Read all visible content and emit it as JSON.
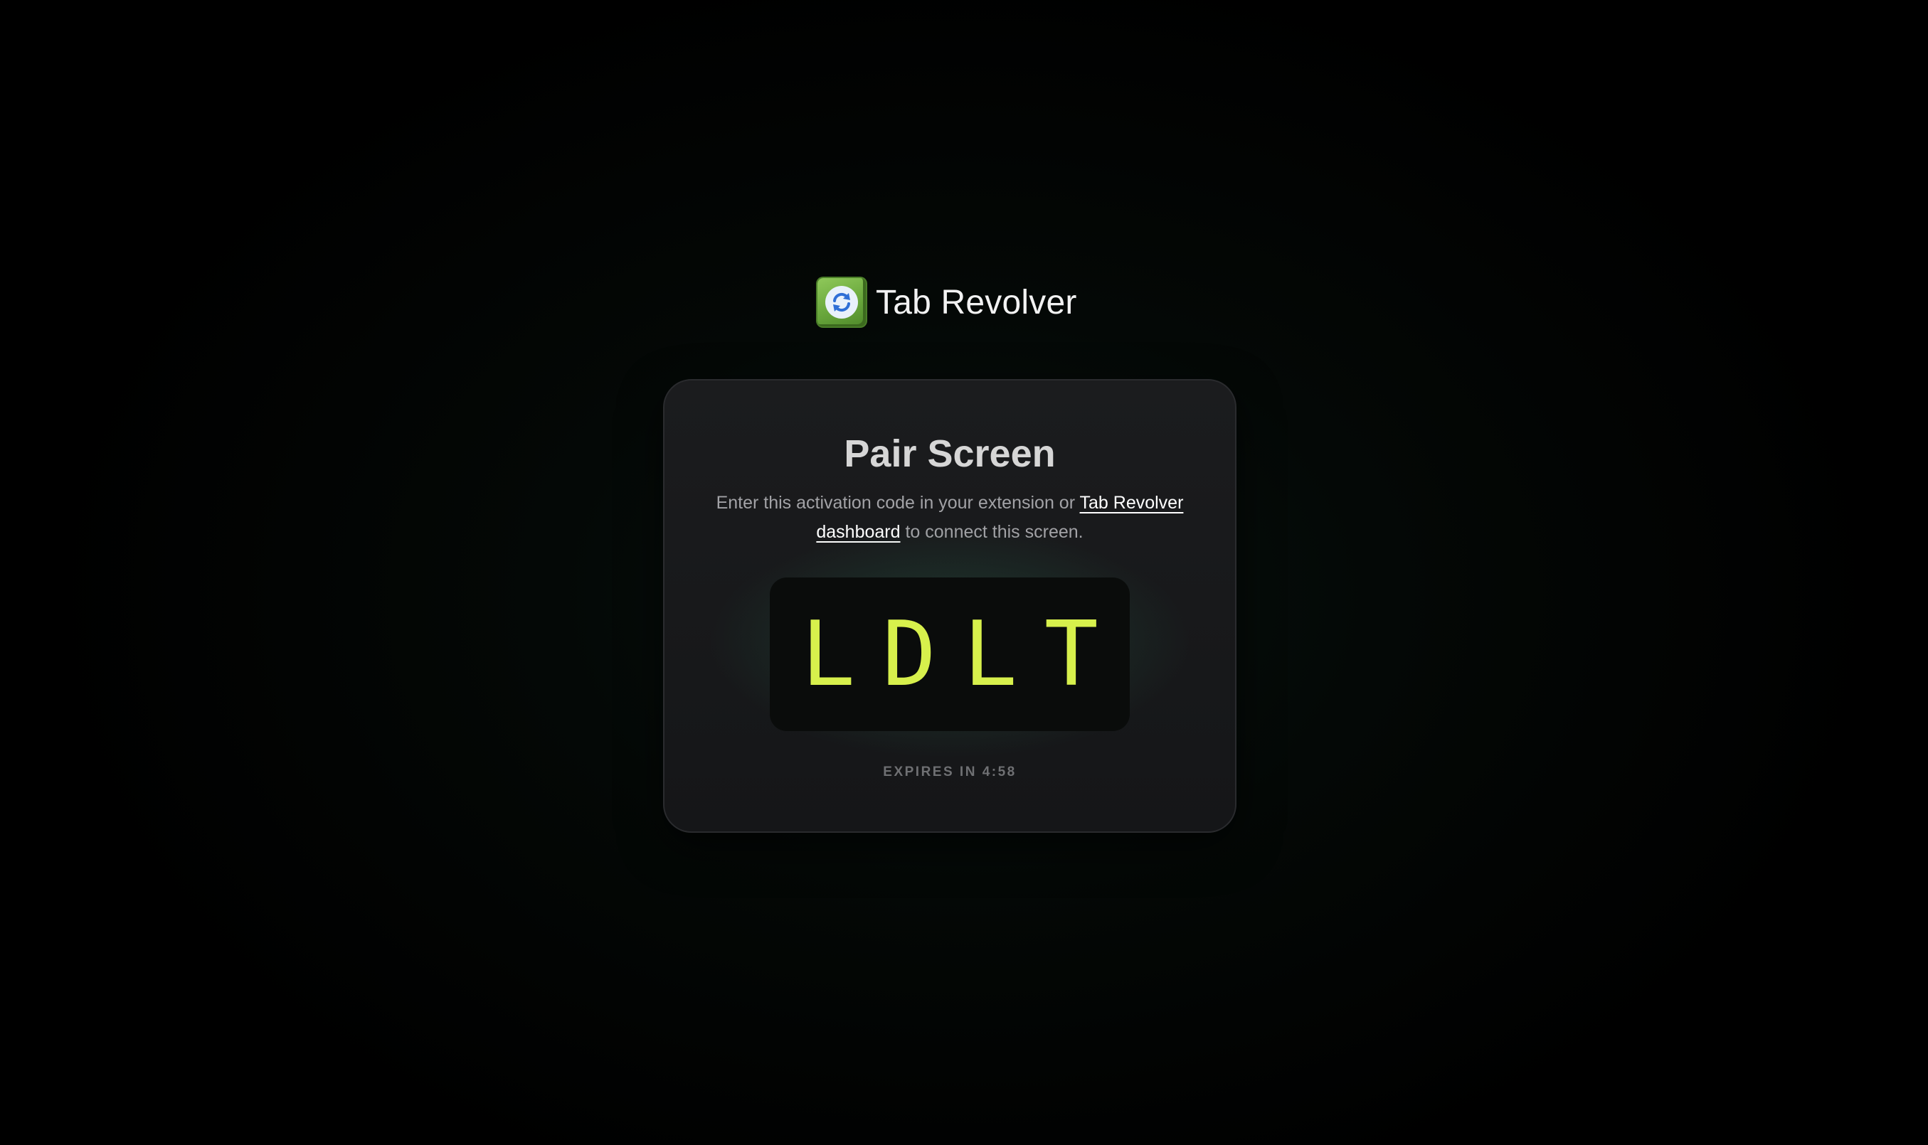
{
  "brand": {
    "name": "Tab Revolver",
    "icon": "refresh-arrows-icon"
  },
  "card": {
    "title": "Pair Screen",
    "description_before": "Enter this activation code in your extension or ",
    "link_text": "Tab Revolver dashboard",
    "description_after": " to connect this screen.",
    "code": "LDLT",
    "expires_text": "EXPIRES IN 4:58"
  },
  "colors": {
    "code": "#d7f04c",
    "brand_icon": "#6aa83d",
    "background": "#000000",
    "card": "#18191b"
  }
}
